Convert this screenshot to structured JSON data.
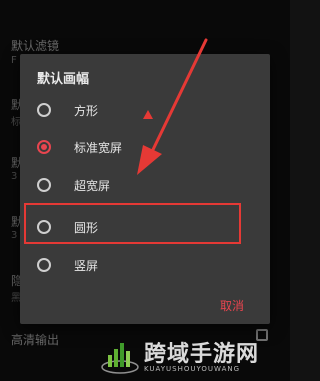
{
  "background": {
    "settings": [
      {
        "label": "默认滤镜",
        "value": "F"
      },
      {
        "label": "默",
        "value": "标"
      },
      {
        "label": "默",
        "value": "3"
      },
      {
        "label": "默",
        "value": "3"
      },
      {
        "label": "隐",
        "value": "黑"
      }
    ],
    "hd_output_label": "高清输出"
  },
  "dialog": {
    "title": "默认画幅",
    "options": [
      {
        "label": "方形",
        "selected": false
      },
      {
        "label": "标准宽屏",
        "selected": true
      },
      {
        "label": "超宽屏",
        "selected": false
      },
      {
        "label": "圆形",
        "selected": false
      },
      {
        "label": "竖屏",
        "selected": false
      }
    ],
    "cancel_label": "取消"
  },
  "watermark": {
    "title": "跨域手游网",
    "subtitle": "KUAYUSHOUYOUWANG"
  },
  "colors": {
    "accent": "#e8454f",
    "annotation": "#e53935",
    "dialog_bg": "#3a3a3a"
  }
}
